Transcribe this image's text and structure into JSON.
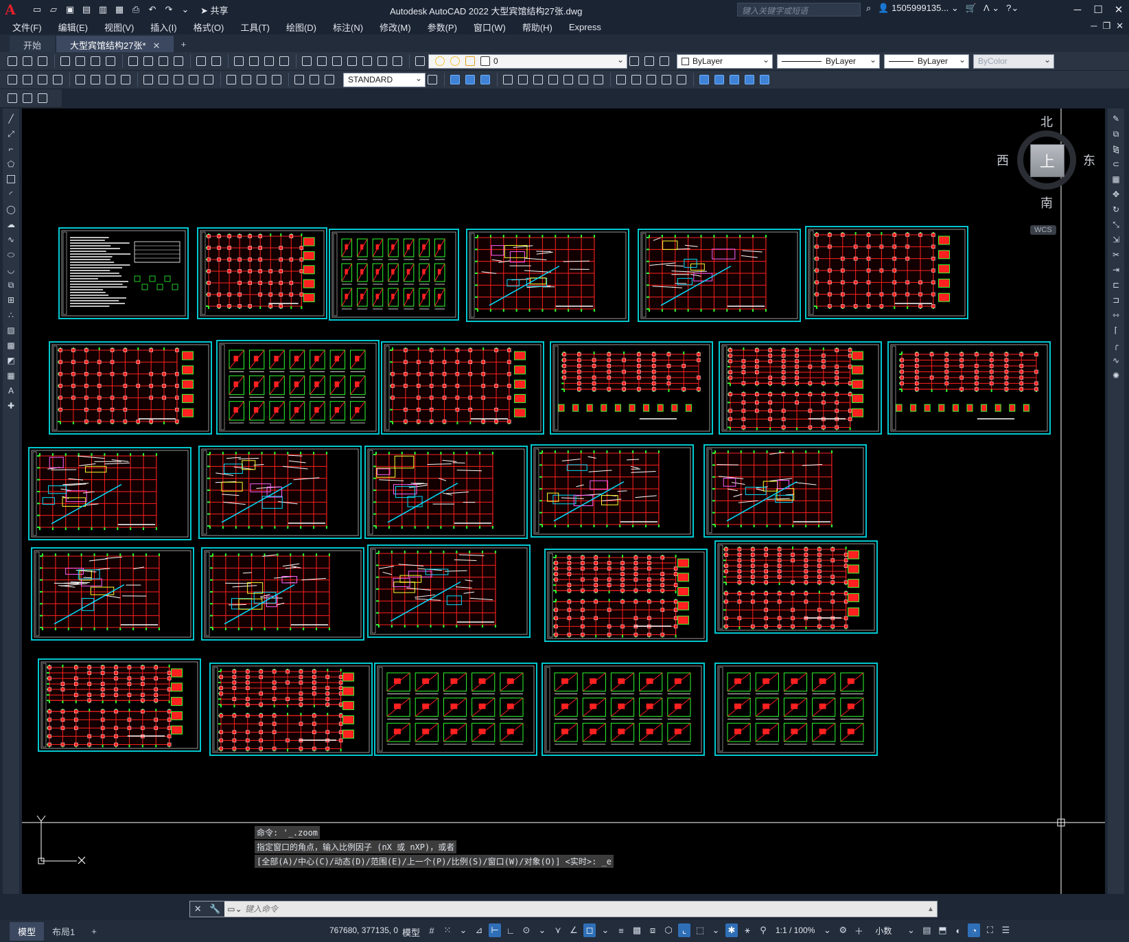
{
  "app": {
    "logo": "A",
    "title": "Autodesk AutoCAD 2022    大型宾馆结构27张.dwg",
    "search_placeholder": "键入关键字或短语",
    "user": "1505999135...",
    "share_label": "共享"
  },
  "menu": [
    "文件(F)",
    "编辑(E)",
    "视图(V)",
    "插入(I)",
    "格式(O)",
    "工具(T)",
    "绘图(D)",
    "标注(N)",
    "修改(M)",
    "参数(P)",
    "窗口(W)",
    "帮助(H)",
    "Express"
  ],
  "tabs": {
    "start": "开始",
    "active_file": "大型宾馆结构27张*"
  },
  "toolbar": {
    "layer_value": "0",
    "color": "ByLayer",
    "linetype": "ByLayer",
    "lineweight": "ByLayer",
    "plotstyle": "ByColor",
    "dimstyle": "STANDARD"
  },
  "viewcube": {
    "north": "北",
    "south": "南",
    "west": "西",
    "east": "东",
    "top": "上",
    "wcs": "WCS"
  },
  "command": {
    "history": [
      "命令: '_.zoom",
      "指定窗口的角点，输入比例因子 (nX 或 nXP)，或者",
      "[全部(A)/中心(C)/动态(D)/范围(E)/上一个(P)/比例(S)/窗口(W)/对象(O)] <实时>: _e"
    ],
    "placeholder": "键入命令"
  },
  "status": {
    "layouts": [
      "模型",
      "布局1"
    ],
    "coordinates": "767680, 377135, 0",
    "mode": "模型",
    "scale": "1:1 / 100%",
    "units": "小数"
  },
  "colors": {
    "background": "#000000",
    "sheet_border": "#00c8d0",
    "grid_red": "#ff2020",
    "grid_green": "#30ff30",
    "accent_blue": "#2f6fb7"
  },
  "drawing_sheets": [
    {
      "kind": "notes"
    },
    {
      "kind": "plan"
    },
    {
      "kind": "details"
    },
    {
      "kind": "slab"
    },
    {
      "kind": "slab"
    },
    {
      "kind": "plan"
    },
    {
      "kind": "plan-side"
    },
    {
      "kind": "details"
    },
    {
      "kind": "plan-side"
    },
    {
      "kind": "strip"
    },
    {
      "kind": "strip2"
    },
    {
      "kind": "strip"
    },
    {
      "kind": "slab"
    },
    {
      "kind": "slab"
    },
    {
      "kind": "slab"
    },
    {
      "kind": "slab"
    },
    {
      "kind": "slab"
    },
    {
      "kind": "slab"
    },
    {
      "kind": "slab"
    },
    {
      "kind": "slab"
    },
    {
      "kind": "strip2"
    },
    {
      "kind": "strip2"
    },
    {
      "kind": "strip2"
    },
    {
      "kind": "strip2"
    },
    {
      "kind": "stairs"
    },
    {
      "kind": "stairs"
    },
    {
      "kind": "stairs"
    }
  ]
}
